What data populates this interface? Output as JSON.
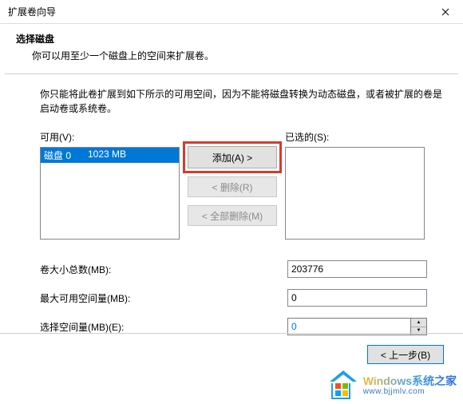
{
  "titlebar": {
    "title": "扩展卷向导"
  },
  "header": {
    "heading": "选择磁盘",
    "subheading": "你可以用至少一个磁盘上的空间来扩展卷。"
  },
  "description": "你只能将此卷扩展到如下所示的可用空间，因为不能将磁盘转换为动态磁盘，或者被扩展的卷是启动卷或系统卷。",
  "available": {
    "label": "可用(V):",
    "items": [
      {
        "disk": "磁盘 0",
        "size": "1023 MB"
      }
    ]
  },
  "selected": {
    "label": "已选的(S):"
  },
  "buttons": {
    "add": "添加(A) >",
    "remove": "< 删除(R)",
    "remove_all": "< 全部删除(M)"
  },
  "fields": {
    "total_label": "卷大小总数(MB):",
    "total_value": "203776",
    "max_label": "最大可用空间量(MB):",
    "max_value": "0",
    "select_label": "选择空间量(MB)(E):",
    "select_value": "0"
  },
  "footer": {
    "back": "< 上一步(B)"
  },
  "watermark": {
    "line1": "Windows系统之家",
    "line2": "www.bjjmlv.com"
  }
}
